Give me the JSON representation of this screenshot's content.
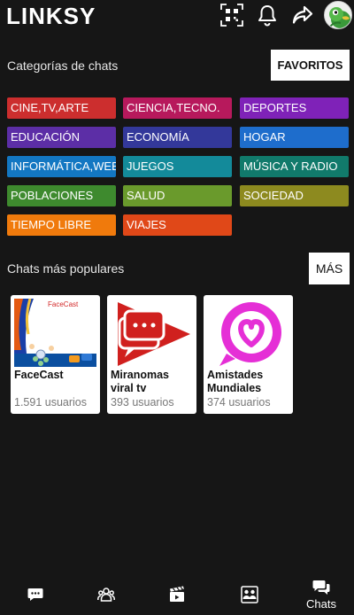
{
  "app": {
    "title": "LINKSY"
  },
  "categories_section": {
    "title": "Categorías de chats",
    "favorites_button": "FAVORITOS",
    "items": [
      {
        "label": "CINE,TV,ARTE",
        "color": "#cc2e2e"
      },
      {
        "label": "CIENCIA,TECNO.",
        "color": "#b7195c"
      },
      {
        "label": "DEPORTES",
        "color": "#7f22b8"
      },
      {
        "label": "EDUCACIÓN",
        "color": "#5c2ea6"
      },
      {
        "label": "ECONOMÍA",
        "color": "#33389a"
      },
      {
        "label": "HOGAR",
        "color": "#1e6dcc"
      },
      {
        "label": "INFORMÁTICA,WEB",
        "color": "#1377c2"
      },
      {
        "label": "JUEGOS",
        "color": "#138a9a"
      },
      {
        "label": "MÚSICA Y RADIO",
        "color": "#117a6b"
      },
      {
        "label": "POBLACIONES",
        "color": "#3e8a2e"
      },
      {
        "label": "SALUD",
        "color": "#6a9a2c"
      },
      {
        "label": "SOCIEDAD",
        "color": "#8d8a1f"
      },
      {
        "label": "TIEMPO LIBRE",
        "color": "#f07a0c"
      },
      {
        "label": "VIAJES",
        "color": "#e04818"
      }
    ]
  },
  "popular_section": {
    "title": "Chats más populares",
    "more_button": "MÁS",
    "chats": [
      {
        "name": "FaceCast",
        "users": "1.591 usuarios",
        "thumb_text": "FaceCast"
      },
      {
        "name": "Miranomas viral tv",
        "users": "393 usuarios"
      },
      {
        "name": "Amistades Mundiales",
        "users": "374 usuarios"
      }
    ]
  },
  "bottom_nav": {
    "items": [
      {
        "icon": "message-icon",
        "label": ""
      },
      {
        "icon": "group-icon",
        "label": ""
      },
      {
        "icon": "clapperboard-icon",
        "label": ""
      },
      {
        "icon": "contacts-icon",
        "label": ""
      },
      {
        "icon": "chats-icon",
        "label": "Chats"
      }
    ]
  },
  "colors": {
    "background": "#161616",
    "white": "#ffffff"
  }
}
